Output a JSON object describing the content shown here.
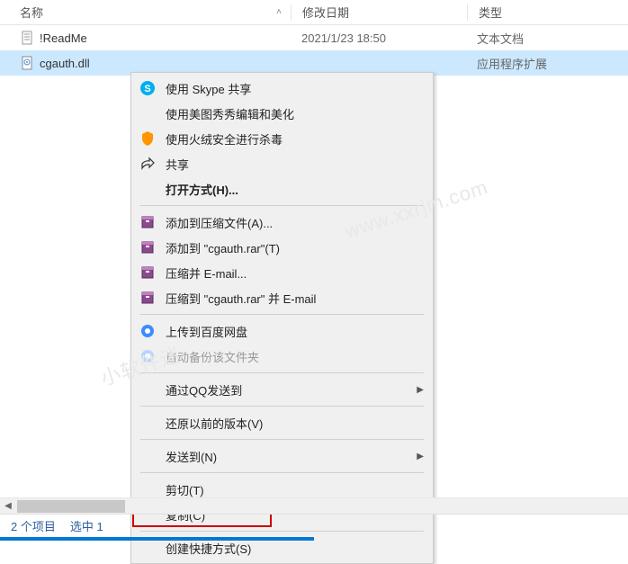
{
  "columns": {
    "name": "名称",
    "date": "修改日期",
    "type": "类型"
  },
  "files": [
    {
      "name": "!ReadMe",
      "date": "2021/1/23 18:50",
      "type": "文本文档",
      "icon": "text-file",
      "selected": false
    },
    {
      "name": "cgauth.dll",
      "date": "",
      "type": "应用程序扩展",
      "icon": "dll-file",
      "selected": true
    }
  ],
  "context_menu": {
    "items": [
      {
        "label": "使用 Skype 共享",
        "icon": "skype",
        "type": "item"
      },
      {
        "label": "使用美图秀秀编辑和美化",
        "icon": "none",
        "type": "item"
      },
      {
        "label": "使用火绒安全进行杀毒",
        "icon": "huorong",
        "type": "item"
      },
      {
        "label": "共享",
        "icon": "share",
        "type": "item"
      },
      {
        "label": "打开方式(H)...",
        "icon": "none",
        "type": "item",
        "bold": true
      },
      {
        "type": "separator"
      },
      {
        "label": "添加到压缩文件(A)...",
        "icon": "rar",
        "type": "item"
      },
      {
        "label": "添加到 \"cgauth.rar\"(T)",
        "icon": "rar",
        "type": "item"
      },
      {
        "label": "压缩并 E-mail...",
        "icon": "rar",
        "type": "item"
      },
      {
        "label": "压缩到 \"cgauth.rar\" 并 E-mail",
        "icon": "rar",
        "type": "item"
      },
      {
        "type": "separator"
      },
      {
        "label": "上传到百度网盘",
        "icon": "baidu",
        "type": "item"
      },
      {
        "label": "自动备份该文件夹",
        "icon": "baidu-gray",
        "type": "item",
        "disabled": true
      },
      {
        "type": "separator"
      },
      {
        "label": "通过QQ发送到",
        "icon": "none",
        "type": "item",
        "arrow": true
      },
      {
        "type": "separator"
      },
      {
        "label": "还原以前的版本(V)",
        "icon": "none",
        "type": "item"
      },
      {
        "type": "separator"
      },
      {
        "label": "发送到(N)",
        "icon": "none",
        "type": "item",
        "arrow": true
      },
      {
        "type": "separator"
      },
      {
        "label": "剪切(T)",
        "icon": "none",
        "type": "item"
      },
      {
        "label": "复制(C)",
        "icon": "none",
        "type": "item",
        "highlighted": true
      },
      {
        "type": "separator"
      },
      {
        "label": "创建快捷方式(S)",
        "icon": "none",
        "type": "item"
      }
    ]
  },
  "status": {
    "items_count": "2 个项目",
    "selected": "选中 1"
  },
  "watermark": "www.xxrjm.com"
}
